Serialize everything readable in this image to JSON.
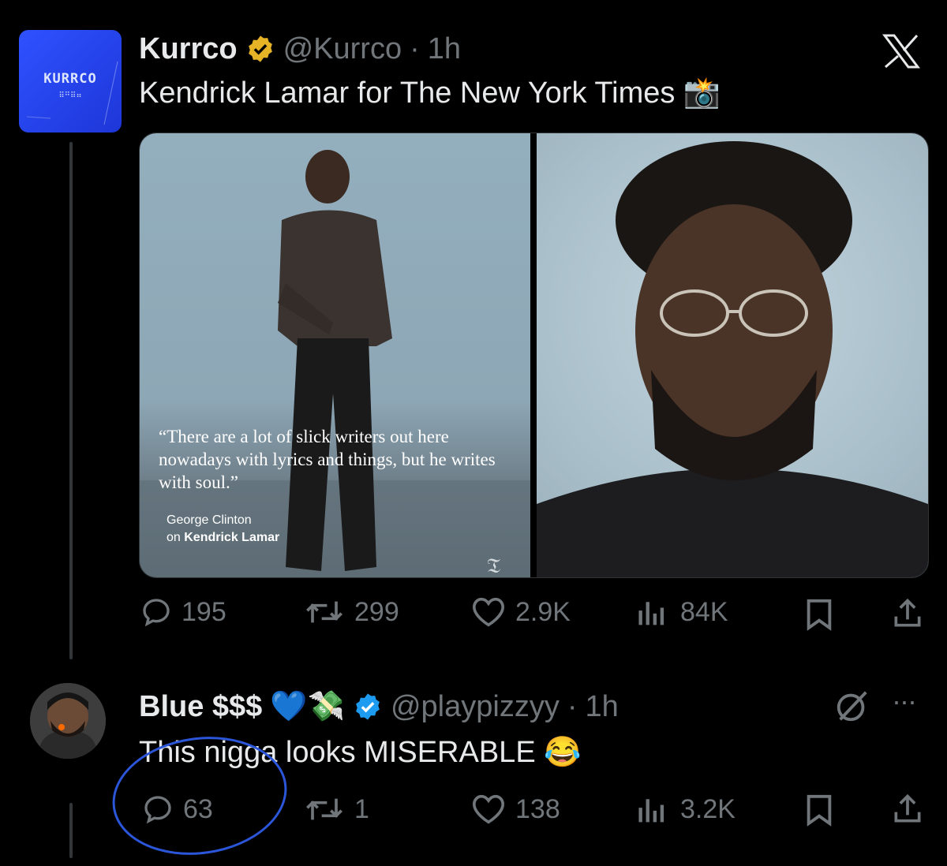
{
  "post": {
    "author_name": "Kurrco",
    "handle": "@Kurrco",
    "time": "1h",
    "text": "Kendrick Lamar for The New York Times 📸",
    "avatar_text": "KURRCO",
    "quote": "“There are a lot of slick writers out here nowadays with lyrics and things, but he writes with soul.”",
    "credit_line1": "George Clinton",
    "credit_line2_prefix": "on",
    "credit_line2_bold": "Kendrick Lamar",
    "counts": {
      "replies": "195",
      "reposts": "299",
      "likes": "2.9K",
      "views": "84K"
    }
  },
  "reply": {
    "author_name": "Blue $$$",
    "emojis": "💙💸",
    "handle": "@playpizzyy",
    "time": "1h",
    "text": "This nigga looks MISERABLE 😂",
    "counts": {
      "replies": "63",
      "reposts": "1",
      "likes": "138",
      "views": "3.2K"
    }
  },
  "colors": {
    "accent_blue": "#1d9bf0",
    "gold_badge": "#e6b326",
    "annotation": "#2b56d9"
  }
}
